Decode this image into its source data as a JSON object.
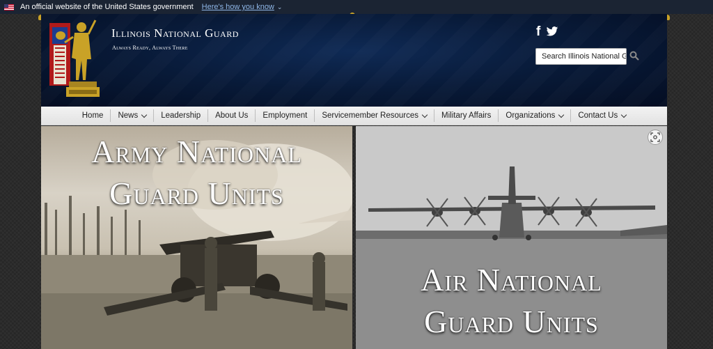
{
  "gov_banner": {
    "text": "An official website of the United States government",
    "link": "Here's how you know",
    "chevron": "⌄"
  },
  "header": {
    "title": "Illinois National Guard",
    "tagline": "Always Ready, Always There",
    "search_placeholder": "Search Illinois National G",
    "social": {
      "facebook": "f"
    }
  },
  "nav": {
    "items": [
      {
        "label": "Home"
      },
      {
        "label": "News"
      },
      {
        "label": "Leadership"
      },
      {
        "label": "About Us"
      },
      {
        "label": "Employment"
      },
      {
        "label": "Servicemember Resources"
      },
      {
        "label": "Military Affairs"
      },
      {
        "label": "Organizations"
      },
      {
        "label": "Contact Us"
      }
    ]
  },
  "panels": {
    "army": {
      "line1": "Army National",
      "line2": "Guard Units"
    },
    "air": {
      "line1": "Air National",
      "line2": "Guard Units"
    }
  },
  "colors": {
    "gov_banner_bg": "#1b2433",
    "header_bg": "#081a38",
    "nav_bg": "#e8e8e8",
    "gold": "#c9a227"
  }
}
